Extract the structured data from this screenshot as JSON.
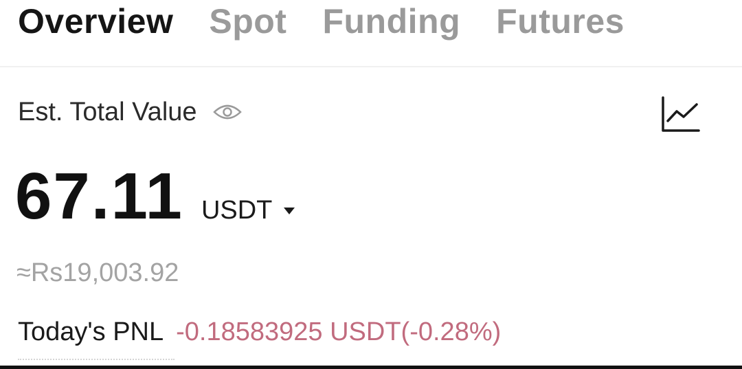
{
  "tabs": [
    {
      "label": "Overview",
      "active": true
    },
    {
      "label": "Spot",
      "active": false
    },
    {
      "label": "Funding",
      "active": false
    },
    {
      "label": "Futures",
      "active": false
    }
  ],
  "balance": {
    "label": "Est. Total Value",
    "visibility_icon": "eye-icon",
    "chart_icon": "line-chart-icon",
    "value": "67.11",
    "currency": "USDT",
    "currency_dropdown_icon": "caret-down-icon",
    "approx_value": "≈Rs19,003.92"
  },
  "pnl": {
    "label": "Today's PNL",
    "value": "-0.18583925 USDT(-0.28%)"
  },
  "colors": {
    "active_tab": "#151515",
    "inactive_tab": "#9a9a9a",
    "pnl_negative": "#c16b7e",
    "muted_text": "#a3a3a3"
  }
}
